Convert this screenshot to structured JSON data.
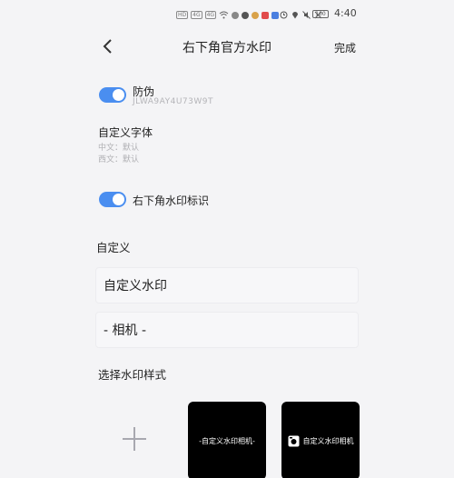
{
  "status_bar": {
    "time": "4:40",
    "battery": "100"
  },
  "header": {
    "title": "右下角官方水印",
    "done_label": "完成"
  },
  "anti_fake": {
    "label": "防伪",
    "code": "JLWA9AY4U73W9T",
    "enabled": true
  },
  "custom_font": {
    "title": "自定义字体",
    "chinese_label": "中文：默认",
    "western_label": "西文：默认"
  },
  "corner_mark": {
    "label": "右下角水印标识",
    "enabled": true
  },
  "custom": {
    "section_title": "自定义",
    "watermark_input": "自定义水印",
    "camera_input": "- 相机 -"
  },
  "styles": {
    "section_title": "选择水印样式",
    "tile1_text": "-自定义水印相机-",
    "tile2_text": "自定义水印相机"
  },
  "colors": {
    "accent": "#4a8ef0",
    "tile_bg": "#000000",
    "page_bg": "#f4f4f6"
  }
}
